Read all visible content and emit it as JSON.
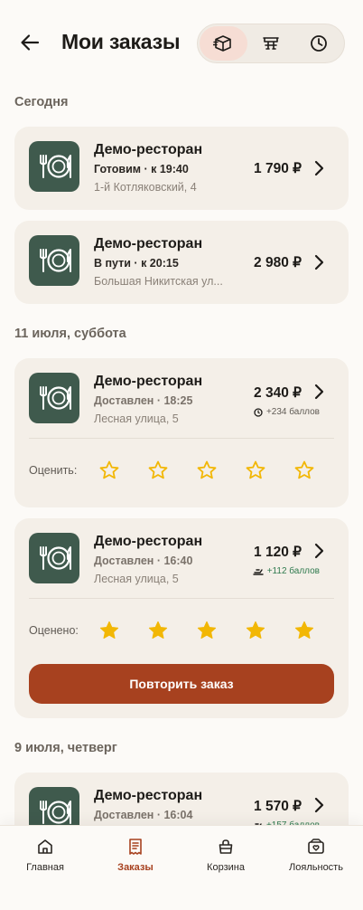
{
  "header": {
    "title": "Мои заказы",
    "tabs": [
      {
        "icon": "box-icon",
        "active": true
      },
      {
        "icon": "table-icon",
        "active": false
      },
      {
        "icon": "clock-icon",
        "active": false
      }
    ]
  },
  "sections": [
    {
      "title": "Сегодня"
    },
    {
      "title": "11 июля, суббота"
    },
    {
      "title": "9 июля, четверг"
    }
  ],
  "orders": [
    {
      "name": "Демо-ресторан",
      "status": "Готовим · к 19:40",
      "address": "1-й Котляковский, 4",
      "price": "1 790 ₽"
    },
    {
      "name": "Демо-ресторан",
      "status": "В пути · к 20:15",
      "address": "Большая Никитская ул...",
      "price": "2 980 ₽"
    },
    {
      "name": "Демо-ресторан",
      "status": "Доставлен · 18:25",
      "address": "Лесная улица, 5",
      "price": "2 340 ₽",
      "bonus": "+234 баллов",
      "rating_label": "Оценить:",
      "rating": 0
    },
    {
      "name": "Демо-ресторан",
      "status": "Доставлен · 16:40",
      "address": "Лесная улица, 5",
      "price": "1 120 ₽",
      "bonus": "+112 баллов",
      "rating_label": "Оценено:",
      "rating": 5,
      "repeat_label": "Повторить заказ"
    },
    {
      "name": "Демо-ресторан",
      "status": "Доставлен · 16:04",
      "price": "1 570 ₽",
      "bonus": "+157 баллов"
    }
  ],
  "nav": [
    {
      "label": "Главная",
      "icon": "home-icon",
      "active": false
    },
    {
      "label": "Заказы",
      "icon": "receipt-icon",
      "active": true
    },
    {
      "label": "Корзина",
      "icon": "bag-icon",
      "active": false
    },
    {
      "label": "Лояльность",
      "icon": "loyalty-icon",
      "active": false
    }
  ],
  "colors": {
    "accent": "#A7411F",
    "logo_bg": "#3F5A4D",
    "star": "#F2B705",
    "bonus_green": "#2F7A4E"
  }
}
